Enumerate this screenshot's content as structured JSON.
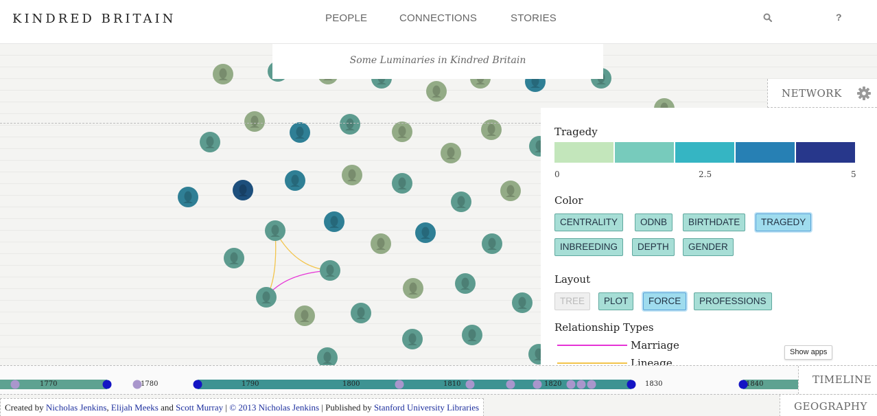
{
  "header": {
    "logo": "KINDRED BRITAIN",
    "nav": {
      "people": "PEOPLE",
      "connections": "CONNECTIONS",
      "stories": "STORIES"
    },
    "search_icon": "search-icon",
    "help_label": "?"
  },
  "subtitle": "Some Luminaries in Kindred Britain",
  "network_tab": {
    "label": "NETWORK",
    "icon": "gear-icon"
  },
  "panel": {
    "tragedy": {
      "heading": "Tragedy",
      "scale_colors": [
        "#c3e6bb",
        "#77cbbc",
        "#35b5c3",
        "#2780b4",
        "#27378b"
      ],
      "ticks": [
        "0",
        "2.5",
        "5"
      ]
    },
    "color": {
      "heading": "Color",
      "options": [
        "CENTRALITY",
        "ODNB",
        "BIRTHDATE",
        "TRAGEDY",
        "INBREEDING",
        "DEPTH",
        "GENDER"
      ],
      "selected": "TRAGEDY"
    },
    "layout": {
      "heading": "Layout",
      "options": [
        "TREE",
        "PLOT",
        "FORCE",
        "PROFESSIONS"
      ],
      "selected": "FORCE",
      "disabled": "TREE"
    },
    "relationship_types": {
      "heading": "Relationship Types",
      "items": [
        {
          "label": "Marriage",
          "color": "#e633d6"
        },
        {
          "label": "Lineage",
          "color": "#f3c44a"
        }
      ]
    }
  },
  "tooltip": "Show apps",
  "timeline": {
    "label": "TIMELINE",
    "year_labels": [
      "1770",
      "1780",
      "1790",
      "1800",
      "1810",
      "1820",
      "1830",
      "1840"
    ]
  },
  "footer": {
    "created_by": "Created by",
    "author1": "Nicholas Jenkins",
    "sep1": ",",
    "author2": "Elijah Meeks",
    "and": "and",
    "author3": "Scott Murray",
    "divider": "|",
    "copyright": "© 2013 Nicholas Jenkins",
    "published_by": "| Published by",
    "publisher": "Stanford University Libraries"
  },
  "geography_tab": {
    "label": "GEOGRAPHY"
  },
  "colors": {
    "teal": "#5d9b8f",
    "green": "#93ab86",
    "blue_teal": "#2f7f95",
    "dark_blue": "#1d4f7c",
    "timeline_bar": "#5ea291",
    "timeline_bar_alt": "#3d9392",
    "timeline_dot": "#1414c4",
    "timeline_dot_muted": "#a996cc"
  }
}
